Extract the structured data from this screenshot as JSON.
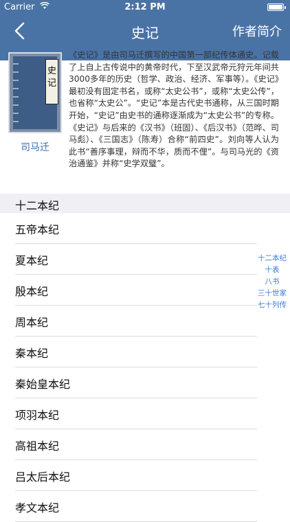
{
  "status_bar": {
    "carrier": "Carrier",
    "time": "2:12 PM"
  },
  "nav": {
    "title": "史记",
    "right_label": "作者简介"
  },
  "book": {
    "cover_title": "史记",
    "author": "司马迁",
    "summary": "《史记》是由司马迁撰写的中国第一部纪传体通史。记载了上自上古传说中的黄帝时代，下至汉武帝元狩元年间共3000多年的历史（哲学、政治、经济、军事等）。《史记》最初没有固定书名，或称“太史公书”，或称“太史公传”，也省称“太史公”。“史记”本是古代史书通称，从三国时期开始，“史记”由史书的通称逐渐成为“太史公书”的专称。《史记》与后来的《汉书》（班固）、《后汉书》（范晔、司马彪）、《三国志》（陈寿）合称“前四史”。刘向等人认为此书“善序事理，辩而不华，质而不俚”。与司马光的《资治通鉴》并称“史学双璧”。"
  },
  "section": {
    "title": "十二本纪",
    "items": [
      "五帝本纪",
      "夏本纪",
      "殷本纪",
      "周本纪",
      "秦本纪",
      "秦始皇本纪",
      "项羽本纪",
      "高祖本纪",
      "吕太后本纪",
      "孝文本纪"
    ]
  },
  "index": [
    "十二本纪",
    "十表",
    "八书",
    "三十世家",
    "七十列传"
  ],
  "colors": {
    "header": "#4a73a5",
    "accent": "#3a7bd5",
    "section_bg": "#efeff4"
  },
  "icons": {
    "back": "chevron-left-icon",
    "wifi": "wifi-icon",
    "battery": "battery-icon"
  }
}
